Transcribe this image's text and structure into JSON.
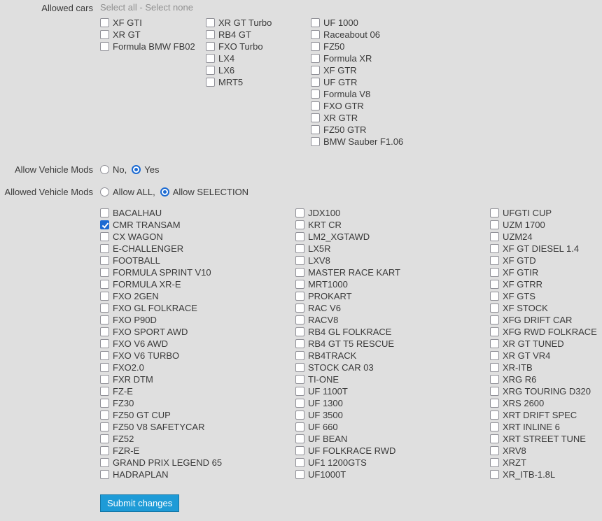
{
  "colors": {
    "page_bg": "#dfdfdf",
    "text": "#3a3a3a",
    "link_gray": "#909090",
    "accent": "#1b6ad2",
    "button_bg": "#1e9bd7",
    "button_border": "#1377a7"
  },
  "allowed_cars": {
    "label": "Allowed cars",
    "select_all": "Select all",
    "separator": " - ",
    "select_none": "Select none",
    "columns": [
      [
        {
          "label": "XF GTI",
          "checked": false
        },
        {
          "label": "XR GT",
          "checked": false
        },
        {
          "label": "Formula BMW FB02",
          "checked": false
        }
      ],
      [
        {
          "label": "XR GT Turbo",
          "checked": false
        },
        {
          "label": "RB4 GT",
          "checked": false
        },
        {
          "label": "FXO Turbo",
          "checked": false
        },
        {
          "label": "LX4",
          "checked": false
        },
        {
          "label": "LX6",
          "checked": false
        },
        {
          "label": "MRT5",
          "checked": false
        }
      ],
      [
        {
          "label": "UF 1000",
          "checked": false
        },
        {
          "label": "Raceabout 06",
          "checked": false
        },
        {
          "label": "FZ50",
          "checked": false
        },
        {
          "label": "Formula XR",
          "checked": false
        },
        {
          "label": "XF GTR",
          "checked": false
        },
        {
          "label": "UF GTR",
          "checked": false
        },
        {
          "label": "Formula V8",
          "checked": false
        },
        {
          "label": "FXO GTR",
          "checked": false
        },
        {
          "label": "XR GTR",
          "checked": false
        },
        {
          "label": "FZ50 GTR",
          "checked": false
        },
        {
          "label": "BMW Sauber F1.06",
          "checked": false
        }
      ]
    ]
  },
  "allow_vehicle_mods": {
    "label": "Allow Vehicle Mods",
    "options": [
      {
        "label": "No,",
        "selected": false
      },
      {
        "label": "Yes",
        "selected": true
      }
    ]
  },
  "allowed_vehicle_mods": {
    "label": "Allowed Vehicle Mods",
    "options": [
      {
        "label": "Allow ALL,",
        "selected": false
      },
      {
        "label": "Allow SELECTION",
        "selected": true
      }
    ]
  },
  "mods": {
    "columns": [
      [
        {
          "label": "BACALHAU",
          "checked": false
        },
        {
          "label": "CMR TRANSAM",
          "checked": true
        },
        {
          "label": "CX WAGON",
          "checked": false
        },
        {
          "label": "E-CHALLENGER",
          "checked": false
        },
        {
          "label": "FOOTBALL",
          "checked": false
        },
        {
          "label": "FORMULA SPRINT V10",
          "checked": false
        },
        {
          "label": "FORMULA XR-E",
          "checked": false
        },
        {
          "label": "FXO 2GEN",
          "checked": false
        },
        {
          "label": "FXO GL FOLKRACE",
          "checked": false
        },
        {
          "label": "FXO P90D",
          "checked": false
        },
        {
          "label": "FXO SPORT AWD",
          "checked": false
        },
        {
          "label": "FXO V6 AWD",
          "checked": false
        },
        {
          "label": "FXO V6 TURBO",
          "checked": false
        },
        {
          "label": "FXO2.0",
          "checked": false
        },
        {
          "label": "FXR DTM",
          "checked": false
        },
        {
          "label": "FZ-E",
          "checked": false
        },
        {
          "label": "FZ30",
          "checked": false
        },
        {
          "label": "FZ50 GT CUP",
          "checked": false
        },
        {
          "label": "FZ50 V8 SAFETYCAR",
          "checked": false
        },
        {
          "label": "FZ52",
          "checked": false
        },
        {
          "label": "FZR-E",
          "checked": false
        },
        {
          "label": "GRAND PRIX LEGEND 65",
          "checked": false
        },
        {
          "label": "HADRAPLAN",
          "checked": false
        }
      ],
      [
        {
          "label": "JDX100",
          "checked": false
        },
        {
          "label": "KRT CR",
          "checked": false
        },
        {
          "label": "LM2_XGTAWD",
          "checked": false
        },
        {
          "label": "LX5R",
          "checked": false
        },
        {
          "label": "LXV8",
          "checked": false
        },
        {
          "label": "MASTER RACE KART",
          "checked": false
        },
        {
          "label": "MRT1000",
          "checked": false
        },
        {
          "label": "PROKART",
          "checked": false
        },
        {
          "label": "RAC V6",
          "checked": false
        },
        {
          "label": "RACV8",
          "checked": false
        },
        {
          "label": "RB4 GL FOLKRACE",
          "checked": false
        },
        {
          "label": "RB4 GT T5 RESCUE",
          "checked": false
        },
        {
          "label": "RB4TRACK",
          "checked": false
        },
        {
          "label": "STOCK CAR 03",
          "checked": false
        },
        {
          "label": "TI-ONE",
          "checked": false
        },
        {
          "label": "UF 1100T",
          "checked": false
        },
        {
          "label": "UF 1300",
          "checked": false
        },
        {
          "label": "UF 3500",
          "checked": false
        },
        {
          "label": "UF 660",
          "checked": false
        },
        {
          "label": "UF BEAN",
          "checked": false
        },
        {
          "label": "UF FOLKRACE RWD",
          "checked": false
        },
        {
          "label": "UF1 1200GTS",
          "checked": false
        },
        {
          "label": "UF1000T",
          "checked": false
        }
      ],
      [
        {
          "label": "UFGTI CUP",
          "checked": false
        },
        {
          "label": "UZM 1700",
          "checked": false
        },
        {
          "label": "UZM24",
          "checked": false
        },
        {
          "label": "XF GT DIESEL 1.4",
          "checked": false
        },
        {
          "label": "XF GTD",
          "checked": false
        },
        {
          "label": "XF GTIR",
          "checked": false
        },
        {
          "label": "XF GTRR",
          "checked": false
        },
        {
          "label": "XF GTS",
          "checked": false
        },
        {
          "label": "XF STOCK",
          "checked": false
        },
        {
          "label": "XFG DRIFT CAR",
          "checked": false
        },
        {
          "label": "XFG RWD FOLKRACE",
          "checked": false
        },
        {
          "label": "XR GT TUNED",
          "checked": false
        },
        {
          "label": "XR GT VR4",
          "checked": false
        },
        {
          "label": "XR-ITB",
          "checked": false
        },
        {
          "label": "XRG R6",
          "checked": false
        },
        {
          "label": "XRG TOURING D320",
          "checked": false
        },
        {
          "label": "XRS 2600",
          "checked": false
        },
        {
          "label": "XRT DRIFT SPEC",
          "checked": false
        },
        {
          "label": "XRT INLINE 6",
          "checked": false
        },
        {
          "label": "XRT STREET TUNE",
          "checked": false
        },
        {
          "label": "XRV8",
          "checked": false
        },
        {
          "label": "XRZT",
          "checked": false
        },
        {
          "label": "XR_ITB-1.8L",
          "checked": false
        }
      ]
    ]
  },
  "submit": {
    "label": "Submit changes"
  }
}
